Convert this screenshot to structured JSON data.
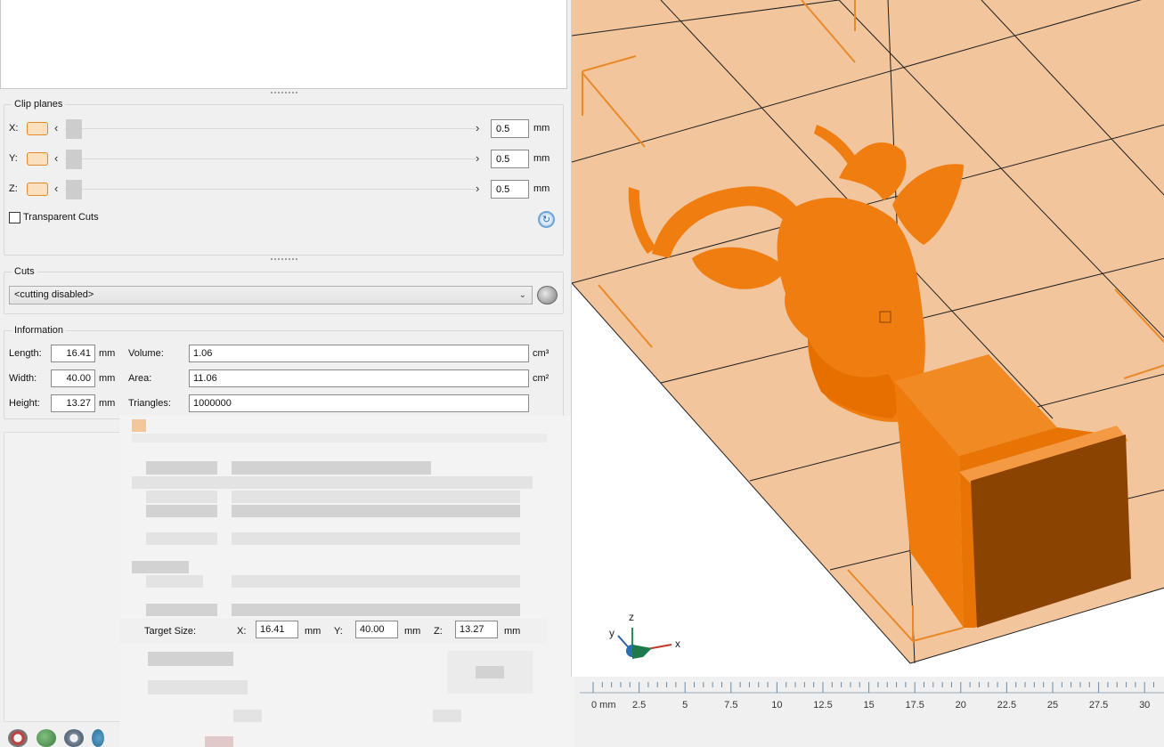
{
  "clip_planes": {
    "title": "Clip planes",
    "rows": [
      {
        "axis": "X:",
        "value": "0.5",
        "unit": "mm"
      },
      {
        "axis": "Y:",
        "value": "0.5",
        "unit": "mm"
      },
      {
        "axis": "Z:",
        "value": "0.5",
        "unit": "mm"
      }
    ],
    "transparent_cuts_label": "Transparent Cuts",
    "transparent_cuts_checked": false
  },
  "cuts": {
    "title": "Cuts",
    "selected": "<cutting disabled>"
  },
  "information": {
    "title": "Information",
    "length_label": "Length:",
    "length_value": "16.41",
    "length_unit": "mm",
    "width_label": "Width:",
    "width_value": "40.00",
    "width_unit": "mm",
    "height_label": "Height:",
    "height_value": "13.27",
    "height_unit": "mm",
    "volume_label": "Volume:",
    "volume_value": "1.06",
    "volume_unit": "cm³",
    "area_label": "Area:",
    "area_value": "11.06",
    "area_unit": "cm²",
    "triangles_label": "Triangles:",
    "triangles_value": "1000000"
  },
  "dialog": {
    "target_size_label": "Target Size:",
    "x_label": "X:",
    "x_value": "16.41",
    "x_unit": "mm",
    "y_label": "Y:",
    "y_value": "40.00",
    "y_unit": "mm",
    "z_label": "Z:",
    "z_value": "13.27",
    "z_unit": "mm"
  },
  "viewport": {
    "axis_labels": {
      "x": "x",
      "y": "y",
      "z": "z"
    },
    "colors": {
      "bed": "#f2c59c",
      "model": "#f07d10",
      "model_dark": "#8a4300",
      "outline": "#e88a2c"
    }
  },
  "ruler": {
    "labels": [
      "0 mm",
      "2.5",
      "5",
      "7.5",
      "10",
      "12.5",
      "15",
      "17.5",
      "20",
      "22.5",
      "25",
      "27.5",
      "30"
    ]
  },
  "toolbar_icons": [
    "add-model-icon",
    "repair-icon",
    "chain-icon",
    "sync-icon"
  ]
}
